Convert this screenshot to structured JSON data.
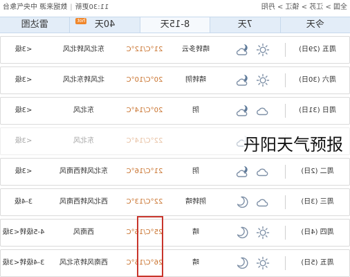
{
  "header": {
    "breadcrumb": "全国 > 江苏 > 镇江 > 丹阳",
    "update_time": "11:30更新",
    "source": "数据来源 中央气象台"
  },
  "tabs": [
    {
      "label": "今天"
    },
    {
      "label": "7天"
    },
    {
      "label": "8-15天",
      "active": true
    },
    {
      "label": "40天",
      "badge": "hot"
    },
    {
      "label": "雷达图"
    }
  ],
  "forecast": [
    {
      "day": "周五 (29日)",
      "day_icon": "sun-icon",
      "night_icon": "cloud-moon-icon",
      "weather": "晴转多云",
      "temp": "21°C/12°C",
      "wind_dir": "东北风转北风",
      "wind_level": "<3级"
    },
    {
      "day": "周六 (30日)",
      "day_icon": "sun-icon",
      "night_icon": "cloud-moon-icon",
      "weather": "晴转阴",
      "temp": "20°C/10°C",
      "wind_dir": "北风转东北风",
      "wind_level": "<3级"
    },
    {
      "day": "周日 (31日)",
      "day_icon": "cloud-icon",
      "night_icon": "cloud-moon-icon",
      "weather": "阴",
      "temp": "20°C/14°C",
      "wind_dir": "东北风",
      "wind_level": "<3级"
    },
    {
      "day": "",
      "day_icon": "",
      "night_icon": "cloud-moon-icon",
      "weather": "",
      "temp": "22°C/14°C",
      "wind_dir": "东北风",
      "wind_level": "<3级",
      "faded": true
    },
    {
      "day": "周二 (2日)",
      "day_icon": "cloud-icon",
      "night_icon": "cloud-moon-icon",
      "weather": "阴",
      "temp": "21°C/16°C",
      "wind_dir": "东北风转西南风",
      "wind_level": "<3级"
    },
    {
      "day": "周三 (3日)",
      "day_icon": "cloud-icon",
      "night_icon": "moon-icon",
      "weather": "阴转晴",
      "temp": "22°C/13°C",
      "wind_dir": "西北风转西南风",
      "wind_level": "3-4级"
    },
    {
      "day": "周四 (4日)",
      "day_icon": "sun-icon",
      "night_icon": "moon-icon",
      "weather": "晴",
      "temp": "25°C/16°C",
      "wind_dir": "西南风",
      "wind_level": "4-5级转<3级"
    },
    {
      "day": "周五 (5日)",
      "day_icon": "sun-icon",
      "night_icon": "moon-icon",
      "weather": "晴",
      "temp": "26°C/15°C",
      "wind_dir": "西南风转东北风",
      "wind_level": "3-4级转<3级"
    }
  ],
  "overlay": {
    "title": "丹阳天气预报"
  },
  "colors": {
    "tab_bar": "#e3edf8",
    "temperature": "#c8702a",
    "highlight": "#c8352b",
    "hot_badge": "#f0862a",
    "icon": "#7d8fa6"
  }
}
